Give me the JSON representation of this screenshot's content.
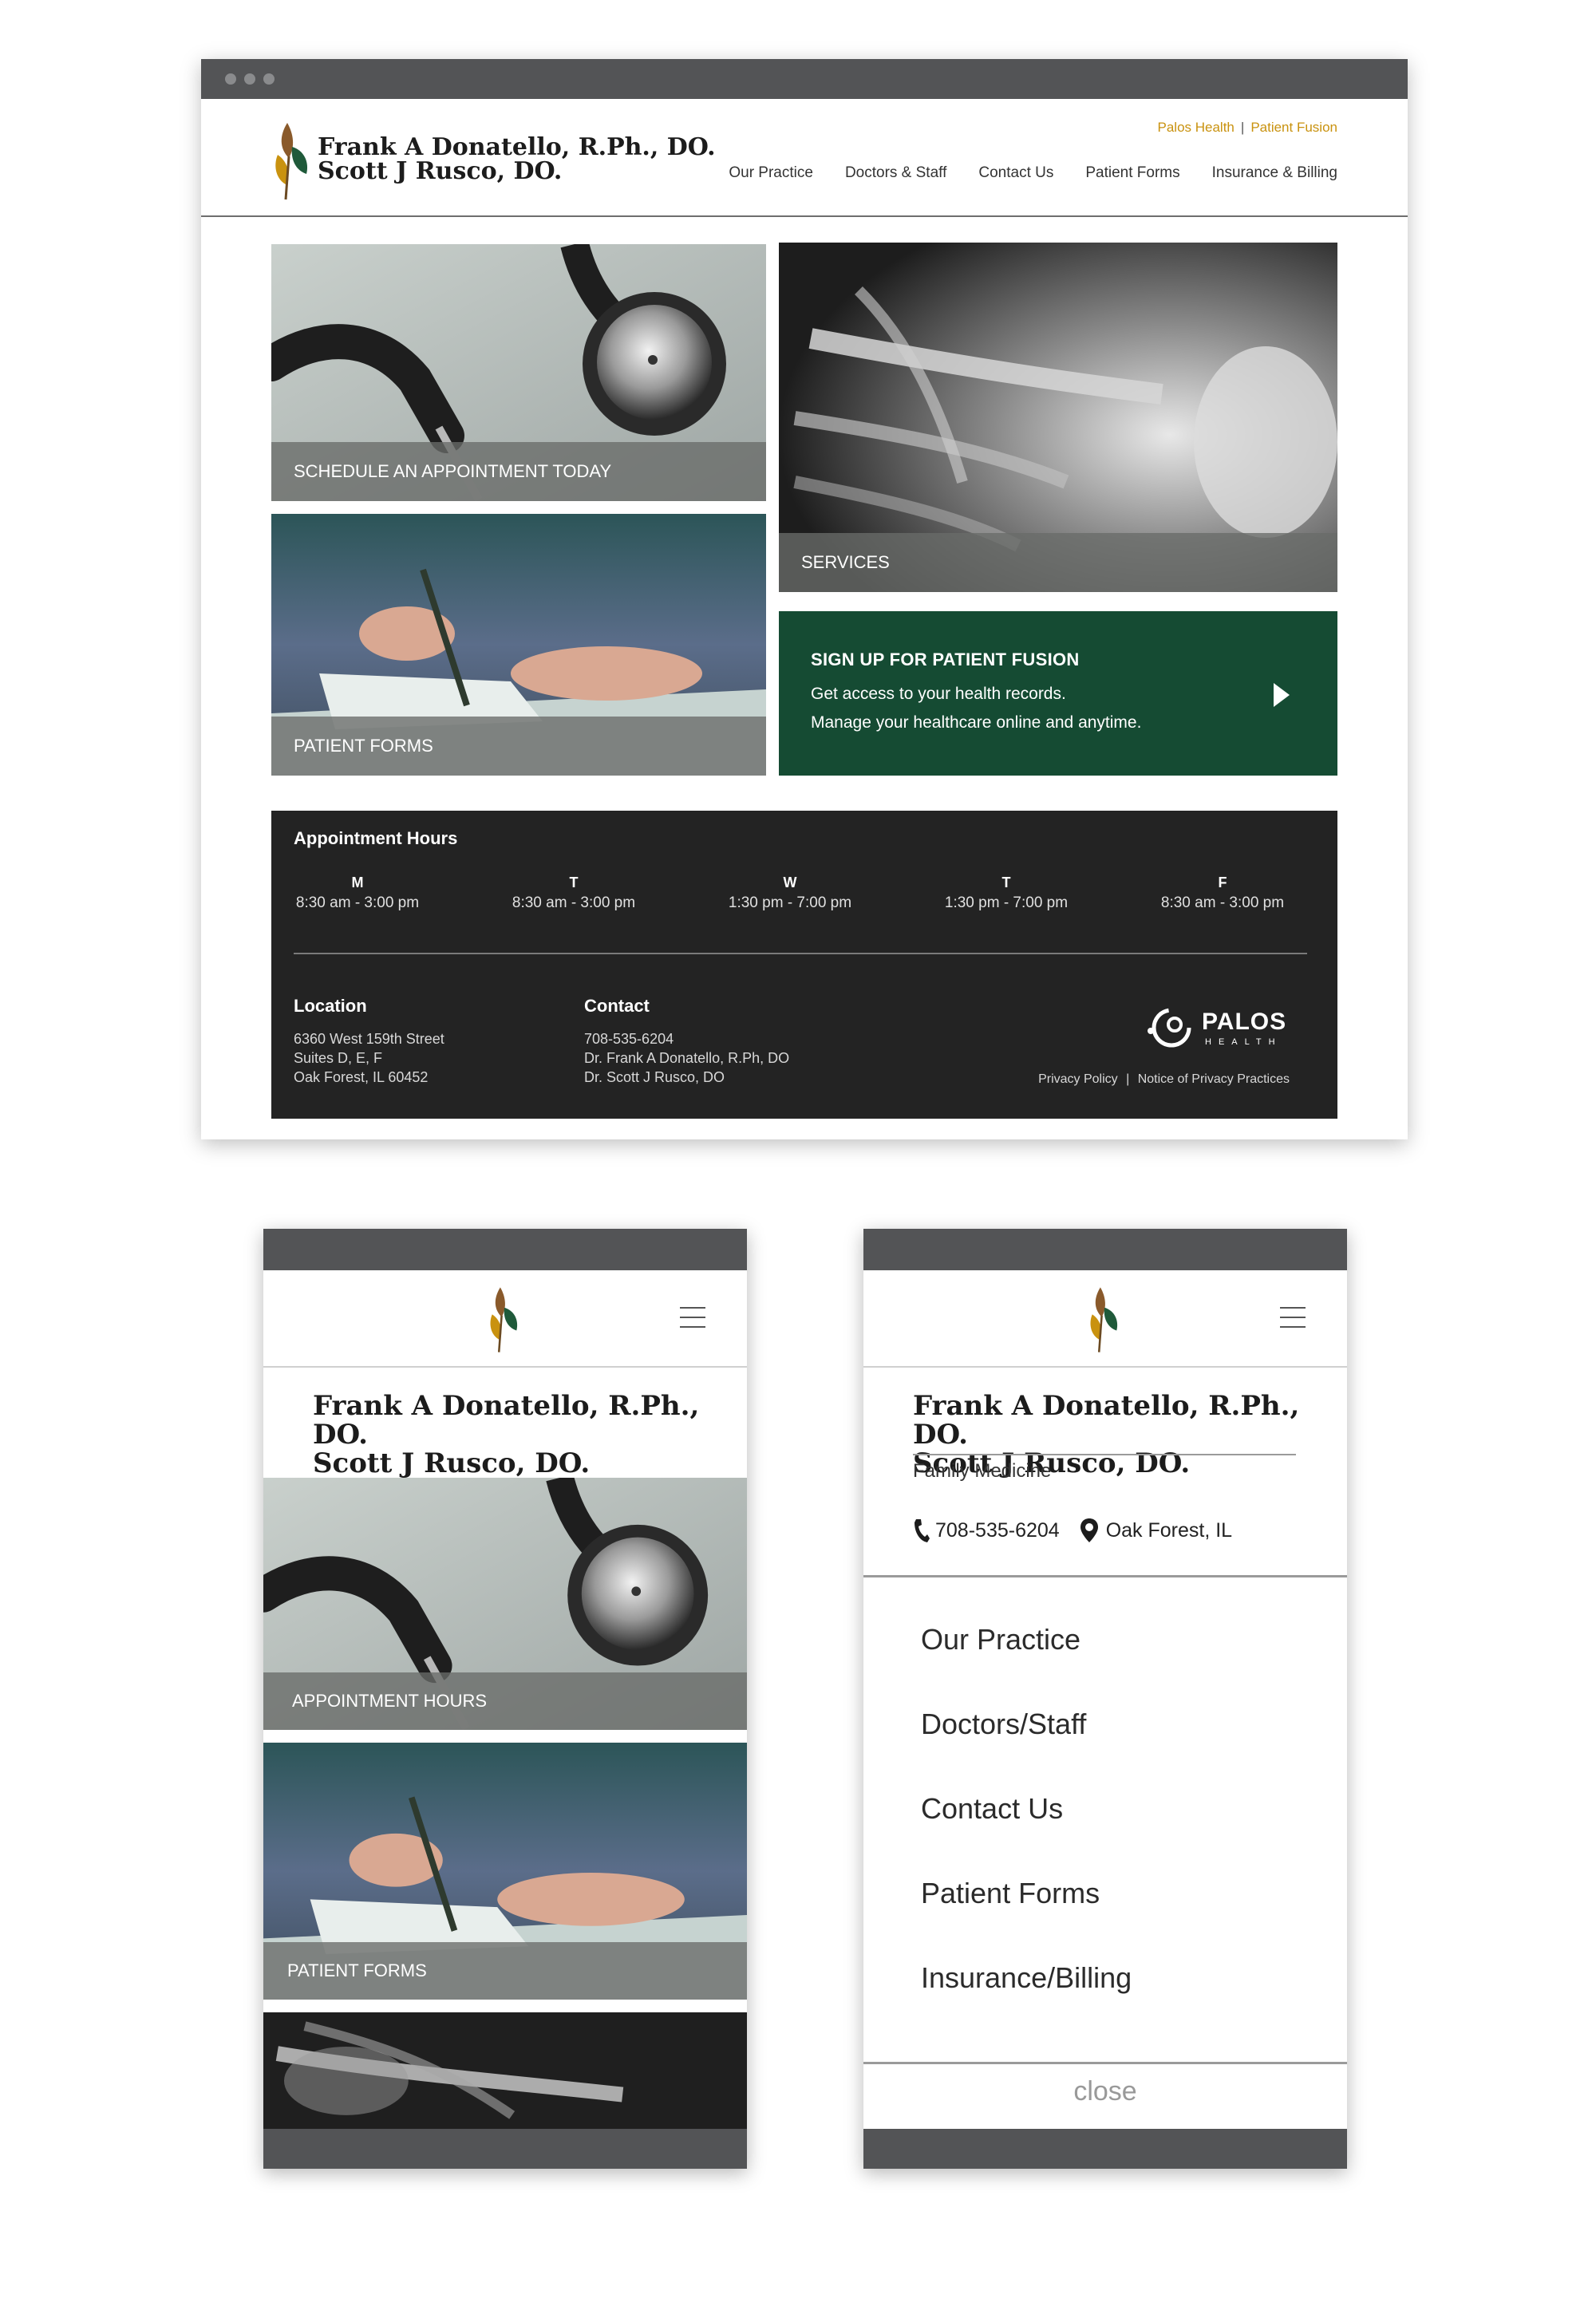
{
  "desktop": {
    "site_title_line1": "Frank A Donatello, R.Ph., DO.",
    "site_title_line2": "Scott J Rusco, DO.",
    "utility_links": [
      "Palos Health",
      "Patient Fusion"
    ],
    "nav": [
      "Our Practice",
      "Doctors & Staff",
      "Contact Us",
      "Patient Forms",
      "Insurance & Billing"
    ],
    "tiles": {
      "schedule": "SCHEDULE AN APPOINTMENT TODAY",
      "services": "SERVICES",
      "forms": "PATIENT FORMS"
    },
    "fusion": {
      "title": "SIGN UP FOR PATIENT FUSION",
      "line1": "Get access to your health records.",
      "line2": "Manage your healthcare online and anytime."
    },
    "footer": {
      "hours_heading": "Appointment Hours",
      "days": [
        {
          "day": "M",
          "hours": "8:30 am - 3:00 pm"
        },
        {
          "day": "T",
          "hours": "8:30 am - 3:00 pm"
        },
        {
          "day": "W",
          "hours": "1:30 pm - 7:00 pm"
        },
        {
          "day": "T",
          "hours": "1:30 pm - 7:00 pm"
        },
        {
          "day": "F",
          "hours": "8:30 am - 3:00 pm"
        }
      ],
      "location_heading": "Location",
      "location_lines": [
        "6360 West 159th Street",
        "Suites D, E, F",
        "Oak Forest, IL 60452"
      ],
      "contact_heading": "Contact",
      "contact_lines": [
        "708-535-6204",
        "Dr. Frank A Donatello, R.Ph, DO",
        "Dr. Scott J Rusco, DO"
      ],
      "brand_name": "PALOS",
      "brand_sub": "HEALTH",
      "legal": [
        "Privacy Policy",
        "Notice of Privacy Practices"
      ]
    }
  },
  "phone_left": {
    "title_line1": "Frank A Donatello, R.Ph., DO.",
    "title_line2": "Scott J Rusco, DO.",
    "tile1": "APPOINTMENT HOURS",
    "tile2": "PATIENT FORMS"
  },
  "phone_right": {
    "title_line1": "Frank A Donatello, R.Ph., DO.",
    "title_line2": "Scott J Rusco, DO.",
    "subtitle": "Family Medicine",
    "phone": "708-535-6204",
    "location": "Oak Forest, IL",
    "menu": [
      "Our Practice",
      "Doctors/Staff",
      "Contact Us",
      "Patient Forms",
      "Insurance/Billing"
    ],
    "close": "close"
  },
  "colors": {
    "accent_gold": "#c9920f",
    "brand_green": "#154b33",
    "footer_dark": "#232323",
    "chrome_gray": "#535456"
  }
}
